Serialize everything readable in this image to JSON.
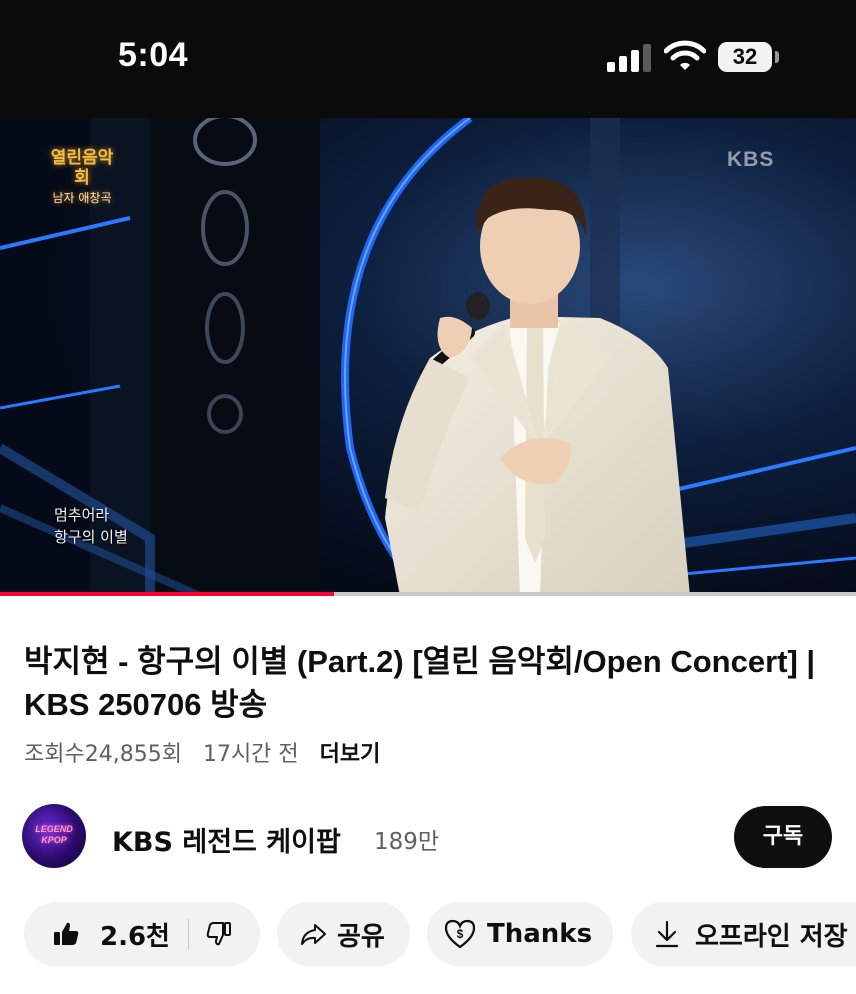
{
  "status_bar": {
    "time": "5:04",
    "battery_level": "32",
    "signal_bars": 3,
    "icons": [
      "cellular-signal-icon",
      "wifi-icon",
      "battery-icon"
    ]
  },
  "video": {
    "show_logo_title": "열린음악회",
    "show_logo_subtitle": "남자 애창곡",
    "broadcaster_watermark": "KBS",
    "caption_line1": "멈추어라",
    "caption_line2": "항구의 이별",
    "progress_fraction": 0.39,
    "progress_color": "#ff0033"
  },
  "info": {
    "title": "박지현 - 항구의 이별 (Part.2) [열린 음악회/Open Concert] | KBS 250706 방송",
    "views": "조회수24,855회",
    "age": "17시간 전",
    "more_label": "더보기"
  },
  "channel": {
    "avatar_text": "LEGEND KPOP",
    "name": "KBS 레전드 케이팝",
    "subscribers": "189만",
    "subscribe_label": "구독"
  },
  "actions": {
    "like_count": "2.6천",
    "share_label": "공유",
    "thanks_label": "Thanks",
    "offline_label": "오프라인 저장",
    "icons": [
      "thumbs-up-icon",
      "thumbs-down-icon",
      "share-icon",
      "thanks-heart-icon",
      "download-icon"
    ]
  }
}
